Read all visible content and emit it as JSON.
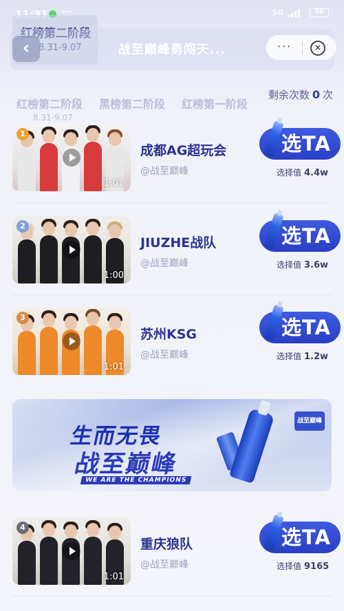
{
  "status_bar": {
    "time": "11:31",
    "more": "···",
    "network": "5G",
    "battery": "59"
  },
  "stage": {
    "title": "红榜第二阶段",
    "date": "8.31-9.07"
  },
  "nav": {
    "back": "‹",
    "title": "战至巅峰勇闯天...",
    "more": "···",
    "close": "×"
  },
  "remaining": {
    "label": "剩余次数",
    "count": "0",
    "unit": "次"
  },
  "tab_strip": [
    {
      "label": "红榜第二阶段",
      "date": "8.31-9.07"
    },
    {
      "label": "黑榜第二阶段",
      "date": ""
    },
    {
      "label": "红榜第一阶段",
      "date": ""
    }
  ],
  "teams": [
    {
      "rank": "1",
      "name": "成都AG超玩会",
      "author": "@战至巅峰",
      "duration": "1:01",
      "button": "选TA",
      "votes_label": "选择值",
      "votes": "4.4w",
      "rank_color": "#f0a030"
    },
    {
      "rank": "2",
      "name": "JIUZHE战队",
      "author": "@战至巅峰",
      "duration": "1:00",
      "button": "选TA",
      "votes_label": "选择值",
      "votes": "3.6w",
      "rank_color": "#7fa1d6"
    },
    {
      "rank": "3",
      "name": "苏州KSG",
      "author": "@战至巅峰",
      "duration": "1:01",
      "button": "选TA",
      "votes_label": "选择值",
      "votes": "1.2w",
      "rank_color": "#d98a4a"
    },
    {
      "rank": "4",
      "name": "重庆狼队",
      "author": "@战至巅峰",
      "duration": "1:01",
      "button": "选TA",
      "votes_label": "选择值",
      "votes": "9165",
      "rank_color": "#6c6c78"
    }
  ],
  "banner": {
    "line1": "生而无畏",
    "line2": "战至巅峰",
    "tagline": "WE ARE THE CHAMPIONS",
    "logo": "战至巅峰"
  },
  "colors": {
    "accent": "#2a3fc4",
    "team_name": "#2a3390",
    "muted": "#9da1bd"
  },
  "icons": {
    "back": "chevron-left-icon",
    "more": "more-dots-icon",
    "close": "close-circle-icon",
    "play": "play-icon"
  }
}
